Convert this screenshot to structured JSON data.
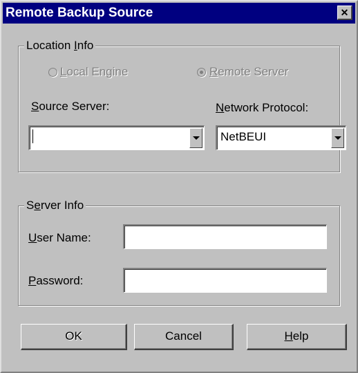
{
  "window": {
    "title": "Remote Backup Source",
    "close_glyph": "✕"
  },
  "location_info": {
    "legend_pre": "Location ",
    "legend_key": "I",
    "legend_post": "nfo",
    "radio_local_key": "L",
    "radio_local_rest": "ocal Engine",
    "radio_local_selected": false,
    "radio_remote_key": "R",
    "radio_remote_rest": "emote Server",
    "radio_remote_selected": true,
    "source_server_key": "S",
    "source_server_rest": "ource Server:",
    "source_server_value": "",
    "network_protocol_key": "N",
    "network_protocol_rest": "etwork Protocol:",
    "network_protocol_value": "NetBEUI"
  },
  "server_info": {
    "legend_pre": "S",
    "legend_key": "e",
    "legend_post": "rver Info",
    "user_name_key": "U",
    "user_name_rest": "ser Name:",
    "user_name_value": "",
    "password_key": "P",
    "password_rest": "assword:",
    "password_value": ""
  },
  "buttons": {
    "ok": "OK",
    "cancel": "Cancel",
    "help_key": "H",
    "help_rest": "elp"
  }
}
